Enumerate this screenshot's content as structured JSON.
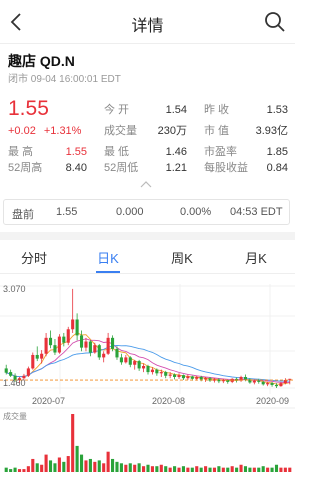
{
  "header": {
    "title": "详情"
  },
  "stock": {
    "name": "趣店 QD.N",
    "status": "闭市 09-04 16:00:01 EDT",
    "price": "1.55",
    "change": "+0.02",
    "change_pct": "+1.31%"
  },
  "quote": {
    "open_label": "今  开",
    "open": "1.54",
    "prev_close_label": "昨  收",
    "prev_close": "1.53",
    "volume_label": "成交量",
    "volume": "230万",
    "mkt_cap_label": "市  值",
    "mkt_cap": "3.93亿",
    "high_label": "最  高",
    "high": "1.55",
    "low_label": "最  低",
    "low": "1.46",
    "pe_label": "市盈率",
    "pe": "1.85",
    "wk52_high_label": "52周高",
    "wk52_high": "8.40",
    "wk52_low_label": "52周低",
    "wk52_low": "1.21",
    "eps_label": "每股收益",
    "eps": "0.84"
  },
  "premarket": {
    "label": "盘前",
    "price": "1.55",
    "change": "0.000",
    "pct": "0.00%",
    "time": "04:53 EDT"
  },
  "tabs": [
    {
      "label": "分时"
    },
    {
      "label": "日K"
    },
    {
      "label": "周K"
    },
    {
      "label": "月K"
    }
  ],
  "active_tab": "日K",
  "colors": {
    "up": "#e8313a",
    "down": "#2aa33a",
    "accent": "#3a7ff1"
  },
  "chart_data": {
    "type": "candlestick",
    "y_ticks": [
      "3.070",
      "1.460"
    ],
    "x_ticks": [
      "2020-07",
      "2020-08",
      "2020-09"
    ],
    "volume_label": "成交量",
    "ylim": [
      1.4,
      3.1
    ],
    "reference_line": 1.53,
    "candles": [
      [
        1.72,
        1.78,
        1.62,
        1.65
      ],
      [
        1.66,
        1.7,
        1.58,
        1.6
      ],
      [
        1.6,
        1.64,
        1.5,
        1.53
      ],
      [
        1.53,
        1.58,
        1.48,
        1.56
      ],
      [
        1.56,
        1.63,
        1.52,
        1.6
      ],
      [
        1.6,
        1.75,
        1.58,
        1.72
      ],
      [
        1.72,
        1.98,
        1.7,
        1.94
      ],
      [
        1.94,
        2.08,
        1.84,
        1.88
      ],
      [
        1.88,
        2.02,
        1.8,
        1.96
      ],
      [
        1.96,
        2.3,
        1.92,
        2.22
      ],
      [
        2.22,
        2.34,
        2.05,
        2.1
      ],
      [
        2.1,
        2.2,
        1.94,
        1.98
      ],
      [
        1.98,
        2.28,
        1.96,
        2.24
      ],
      [
        2.24,
        2.3,
        2.08,
        2.14
      ],
      [
        2.14,
        2.4,
        2.1,
        2.36
      ],
      [
        2.36,
        3.02,
        2.3,
        2.52
      ],
      [
        2.52,
        2.62,
        2.18,
        2.26
      ],
      [
        2.26,
        2.34,
        2.0,
        2.06
      ],
      [
        2.06,
        2.22,
        2.0,
        2.16
      ],
      [
        2.16,
        2.18,
        1.92,
        1.98
      ],
      [
        1.98,
        2.14,
        1.96,
        2.1
      ],
      [
        2.1,
        2.12,
        1.86,
        1.9
      ],
      [
        1.9,
        2.0,
        1.82,
        1.96
      ],
      [
        1.96,
        2.3,
        1.94,
        2.22
      ],
      [
        2.22,
        2.26,
        2.0,
        2.04
      ],
      [
        2.04,
        2.08,
        1.86,
        1.9
      ],
      [
        1.9,
        1.96,
        1.78,
        1.82
      ],
      [
        1.82,
        1.94,
        1.8,
        1.9
      ],
      [
        1.9,
        1.92,
        1.74,
        1.78
      ],
      [
        1.78,
        1.86,
        1.7,
        1.84
      ],
      [
        1.84,
        1.86,
        1.68,
        1.72
      ],
      [
        1.72,
        1.8,
        1.66,
        1.76
      ],
      [
        1.76,
        1.78,
        1.62,
        1.66
      ],
      [
        1.66,
        1.74,
        1.62,
        1.7
      ],
      [
        1.7,
        1.72,
        1.6,
        1.64
      ],
      [
        1.64,
        1.7,
        1.58,
        1.66
      ],
      [
        1.66,
        1.68,
        1.56,
        1.6
      ],
      [
        1.6,
        1.66,
        1.56,
        1.62
      ],
      [
        1.62,
        1.64,
        1.54,
        1.58
      ],
      [
        1.58,
        1.64,
        1.55,
        1.61
      ],
      [
        1.61,
        1.62,
        1.53,
        1.56
      ],
      [
        1.56,
        1.62,
        1.53,
        1.59
      ],
      [
        1.59,
        1.6,
        1.52,
        1.55
      ],
      [
        1.55,
        1.6,
        1.52,
        1.58
      ],
      [
        1.58,
        1.6,
        1.51,
        1.54
      ],
      [
        1.54,
        1.58,
        1.5,
        1.56
      ],
      [
        1.56,
        1.58,
        1.5,
        1.52
      ],
      [
        1.52,
        1.56,
        1.49,
        1.54
      ],
      [
        1.54,
        1.56,
        1.48,
        1.51
      ],
      [
        1.51,
        1.55,
        1.48,
        1.53
      ],
      [
        1.53,
        1.54,
        1.47,
        1.5
      ],
      [
        1.5,
        1.56,
        1.48,
        1.55
      ],
      [
        1.55,
        1.57,
        1.49,
        1.52
      ],
      [
        1.52,
        1.6,
        1.5,
        1.58
      ],
      [
        1.58,
        1.62,
        1.51,
        1.54
      ],
      [
        1.54,
        1.56,
        1.47,
        1.49
      ],
      [
        1.49,
        1.54,
        1.46,
        1.52
      ],
      [
        1.52,
        1.55,
        1.47,
        1.5
      ],
      [
        1.5,
        1.52,
        1.44,
        1.46
      ],
      [
        1.46,
        1.5,
        1.43,
        1.48
      ],
      [
        1.48,
        1.5,
        1.42,
        1.45
      ],
      [
        1.45,
        1.48,
        1.4,
        1.43
      ],
      [
        1.43,
        1.5,
        1.42,
        1.48
      ],
      [
        1.48,
        1.56,
        1.46,
        1.53
      ],
      [
        1.54,
        1.55,
        1.46,
        1.55
      ]
    ],
    "volumes": [
      3,
      2,
      3,
      2,
      2,
      4,
      9,
      6,
      5,
      12,
      8,
      6,
      10,
      7,
      11,
      40,
      18,
      12,
      8,
      9,
      7,
      8,
      6,
      14,
      9,
      7,
      6,
      5,
      6,
      5,
      6,
      4,
      5,
      4,
      4,
      5,
      4,
      3,
      4,
      3,
      4,
      3,
      3,
      4,
      3,
      4,
      3,
      3,
      4,
      3,
      3,
      4,
      3,
      5,
      4,
      3,
      3,
      3,
      4,
      3,
      3,
      5,
      3,
      3,
      3
    ]
  }
}
